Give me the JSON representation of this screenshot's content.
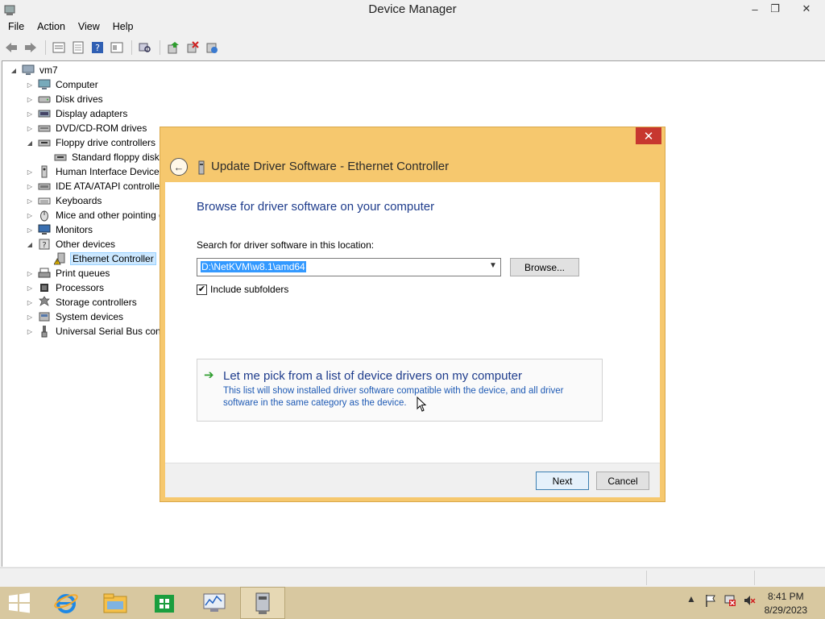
{
  "window": {
    "title": "Device Manager",
    "controls": {
      "minimize": "–",
      "restore": "❐",
      "close": "✕"
    }
  },
  "menu": [
    "File",
    "Action",
    "View",
    "Help"
  ],
  "toolbar": {
    "icons": [
      "back-icon",
      "forward-icon",
      "properties-icon",
      "view-icon",
      "help-icon",
      "show-hide-icon",
      "scan-icon",
      "update-driver-icon",
      "disable-icon",
      "uninstall-icon"
    ]
  },
  "tree": {
    "root": "vm7",
    "items": [
      {
        "label": "Computer",
        "icon": "computer-icon",
        "expand": "▷"
      },
      {
        "label": "Disk drives",
        "icon": "disk-icon",
        "expand": "▷"
      },
      {
        "label": "Display adapters",
        "icon": "display-icon",
        "expand": "▷"
      },
      {
        "label": "DVD/CD-ROM drives",
        "icon": "dvd-icon",
        "expand": "▷"
      },
      {
        "label": "Floppy drive controllers",
        "icon": "floppy-icon",
        "expand": "◢"
      },
      {
        "label": "Standard floppy disk c",
        "icon": "floppy-icon",
        "expand": "",
        "child": true
      },
      {
        "label": "Human Interface Devices",
        "icon": "hid-icon",
        "expand": "▷"
      },
      {
        "label": "IDE ATA/ATAPI controller",
        "icon": "ide-icon",
        "expand": "▷"
      },
      {
        "label": "Keyboards",
        "icon": "keyboard-icon",
        "expand": "▷"
      },
      {
        "label": "Mice and other pointing d",
        "icon": "mouse-icon",
        "expand": "▷"
      },
      {
        "label": "Monitors",
        "icon": "monitor-icon",
        "expand": "▷"
      },
      {
        "label": "Other devices",
        "icon": "unknown-device-icon",
        "expand": "◢"
      },
      {
        "label": "Ethernet Controller",
        "icon": "warning-device-icon",
        "expand": "",
        "child": true,
        "selected": true
      },
      {
        "label": "Print queues",
        "icon": "printer-icon",
        "expand": "▷"
      },
      {
        "label": "Processors",
        "icon": "processor-icon",
        "expand": "▷"
      },
      {
        "label": "Storage controllers",
        "icon": "storage-icon",
        "expand": "▷"
      },
      {
        "label": "System devices",
        "icon": "system-icon",
        "expand": "▷"
      },
      {
        "label": "Universal Serial Bus contro",
        "icon": "usb-icon",
        "expand": "▷"
      }
    ]
  },
  "dialog": {
    "close": "✕",
    "title": "Update Driver Software - Ethernet Controller",
    "heading": "Browse for driver software on your computer",
    "search_label": "Search for driver software in this location:",
    "path_value": "D:\\NetKVM\\w8.1\\amd64",
    "browse_label": "Browse...",
    "include_subfolders_label": "Include subfolders",
    "include_subfolders_checked": true,
    "pick_title": "Let me pick from a list of device drivers on my computer",
    "pick_desc": "This list will show installed driver software compatible with the device, and all driver software in the same category as the device.",
    "next_label": "Next",
    "cancel_label": "Cancel"
  },
  "taskbar": {
    "apps": [
      "internet-explorer-icon",
      "file-explorer-icon",
      "store-icon",
      "performance-monitor-icon",
      "device-manager-icon"
    ],
    "clock_time": "8:41 PM",
    "clock_date": "8/29/2023"
  },
  "colors": {
    "dialog_frame": "#f6c86e",
    "dialog_close": "#c7372f",
    "link_blue": "#1e3c8c",
    "taskbar": "#d8c8a0",
    "selection": "#cce8ff"
  }
}
